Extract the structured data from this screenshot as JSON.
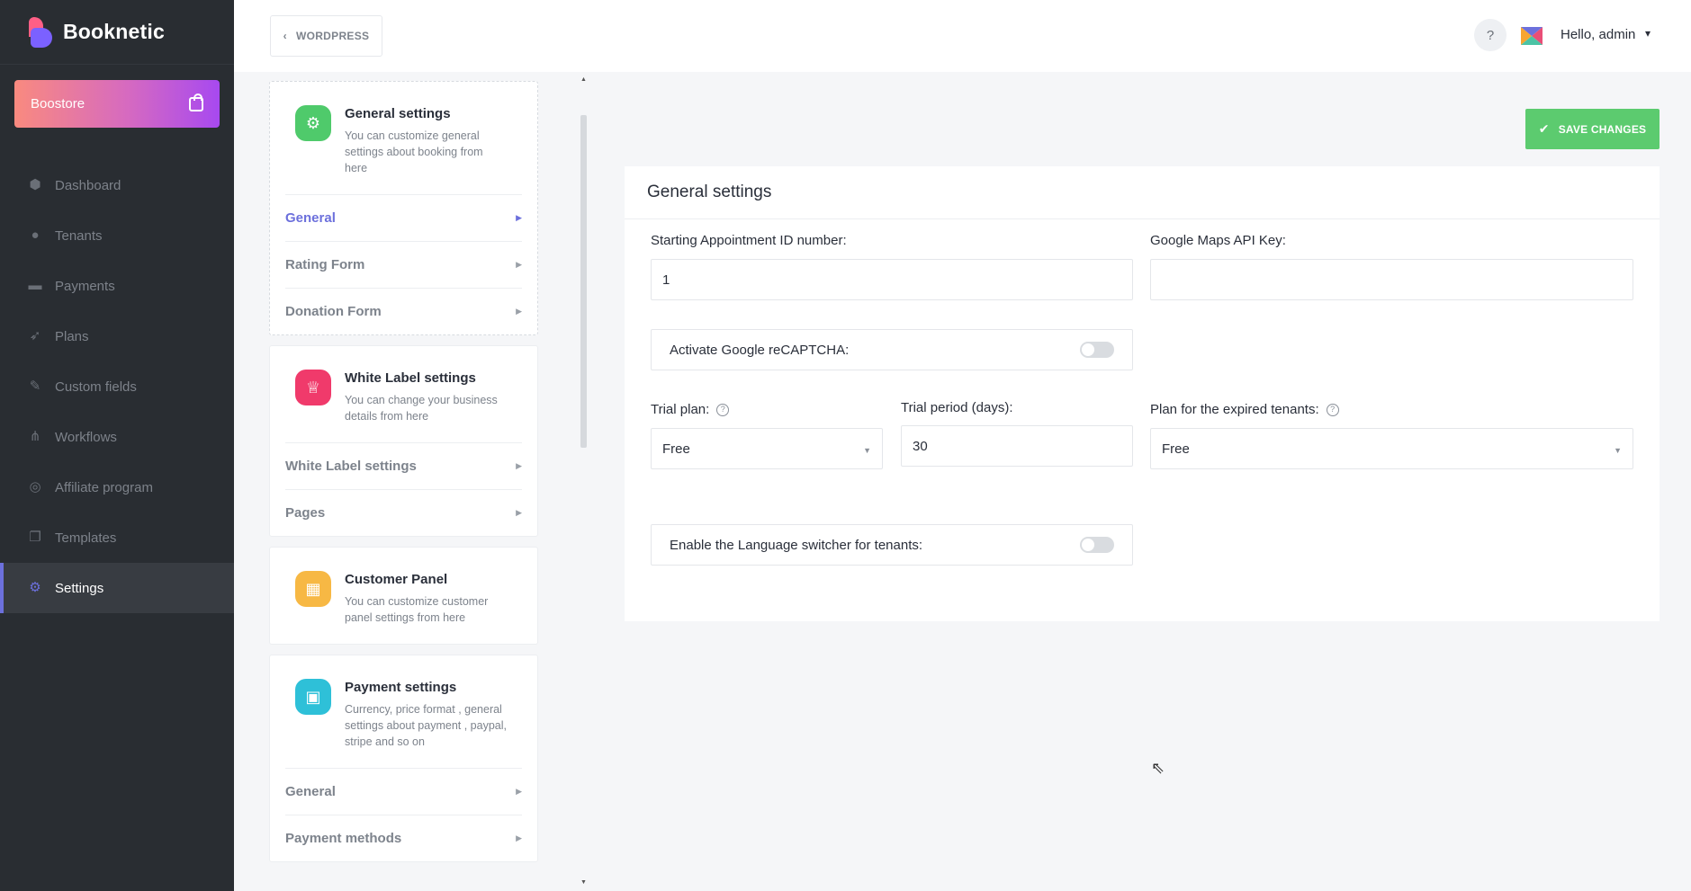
{
  "brand": {
    "name": "Booknetic"
  },
  "boostore": {
    "label": "Boostore"
  },
  "sidebar": {
    "items": [
      {
        "label": "Dashboard",
        "icon": "cube-icon",
        "glyph": "⬢"
      },
      {
        "label": "Tenants",
        "icon": "user-icon",
        "glyph": "●"
      },
      {
        "label": "Payments",
        "icon": "card-icon",
        "glyph": "▬"
      },
      {
        "label": "Plans",
        "icon": "rocket-icon",
        "glyph": "➶"
      },
      {
        "label": "Custom fields",
        "icon": "magic-wand-icon",
        "glyph": "✎"
      },
      {
        "label": "Workflows",
        "icon": "workflow-icon",
        "glyph": "⋔"
      },
      {
        "label": "Affiliate program",
        "icon": "target-icon",
        "glyph": "◎"
      },
      {
        "label": "Templates",
        "icon": "copy-icon",
        "glyph": "❐"
      },
      {
        "label": "Settings",
        "icon": "gear-icon",
        "glyph": "⚙"
      }
    ]
  },
  "header": {
    "back_label": "WORDPRESS",
    "greeting": "Hello, admin"
  },
  "settings_nav": {
    "general": {
      "title": "General settings",
      "desc": "You can customize general settings about booking from here",
      "items": [
        "General",
        "Rating Form",
        "Donation Form"
      ]
    },
    "white_label": {
      "title": "White Label settings",
      "desc": "You can change your business details from here",
      "items": [
        "White Label settings",
        "Pages"
      ]
    },
    "customer_panel": {
      "title": "Customer Panel",
      "desc": "You can customize customer panel settings from here"
    },
    "payment": {
      "title": "Payment settings",
      "desc": "Currency, price format , general settings about payment , paypal, stripe and so on",
      "items": [
        "General",
        "Payment methods"
      ]
    }
  },
  "main": {
    "save_label": "SAVE CHANGES",
    "panel_title": "General settings",
    "fields": {
      "starting_id": {
        "label": "Starting Appointment ID number:",
        "value": "1"
      },
      "maps_key": {
        "label": "Google Maps API Key:",
        "value": ""
      },
      "recaptcha": {
        "label": "Activate Google reCAPTCHA:"
      },
      "trial_plan": {
        "label": "Trial plan:",
        "value": "Free"
      },
      "trial_period": {
        "label": "Trial period (days):",
        "value": "30"
      },
      "expired_plan": {
        "label": "Plan for the expired tenants:",
        "value": "Free"
      },
      "language_switcher": {
        "label": "Enable the Language switcher for tenants:"
      }
    }
  },
  "colors": {
    "accent": "#6c70dc",
    "success": "#5ccb6f",
    "sidebar_bg": "#292d32"
  }
}
